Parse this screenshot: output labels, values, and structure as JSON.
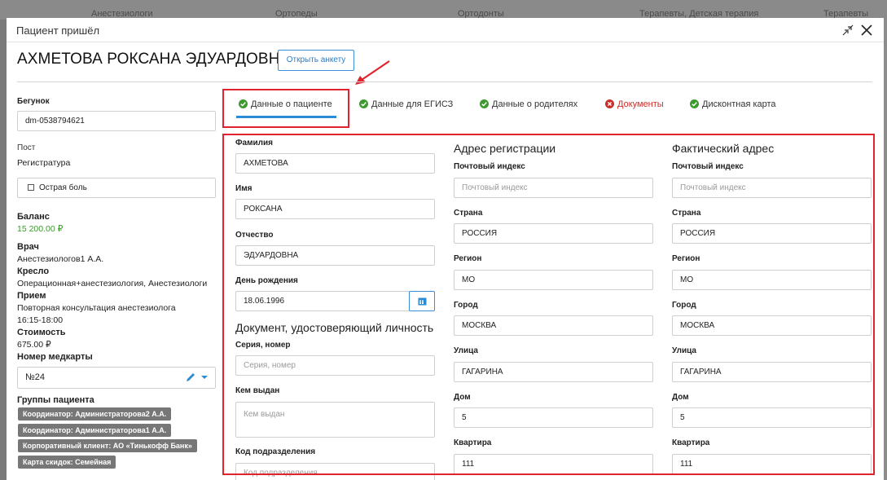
{
  "background": {
    "columns": [
      "Анестезиологи",
      "Ортопеды",
      "Ортодонты",
      "Терапевты, Детская терапия",
      "Терапевты"
    ]
  },
  "modal": {
    "title": "Пациент пришёл",
    "patient_name": "АХМЕТОВА РОКСАНА ЭДУАРДОВНА",
    "open_form_label": "Открыть анкету"
  },
  "left": {
    "runner_label": "Бегунок",
    "runner_value": "dm-0538794621",
    "post_label": "Пост",
    "post_value": "Регистратура",
    "acute_pain_label": "Острая боль",
    "acute_pain_checked": false,
    "balance_label": "Баланс",
    "balance_value": "15 200.00 ₽",
    "doctor_label": "Врач",
    "doctor_value": "Анестезиологов1 А.А.",
    "chair_label": "Кресло",
    "chair_value": "Операционная+анестезиология, Анестезиологи",
    "appointment_label": "Прием",
    "appointment_value": "Повторная консультация анестезиолога",
    "appointment_time": "16:15-18:00",
    "cost_label": "Стоимость",
    "cost_value": "675.00 ₽",
    "card_number_label": "Номер медкарты",
    "card_number_value": "№24",
    "groups_label": "Группы пациента",
    "groups": [
      "Координатор: Администраторова2 А.А.",
      "Координатор: Администраторова1 А.А.",
      "Корпоративный клиент: АО «Тинькофф Банк»",
      "Карта скидок: Семейная"
    ]
  },
  "tabs": [
    {
      "label": "Данные о пациенте",
      "status": "ok",
      "active": true
    },
    {
      "label": "Данные для ЕГИСЗ",
      "status": "ok",
      "active": false
    },
    {
      "label": "Данные о родителях",
      "status": "ok",
      "active": false
    },
    {
      "label": "Документы",
      "status": "error",
      "active": false
    },
    {
      "label": "Дисконтная карта",
      "status": "ok",
      "active": false
    }
  ],
  "form": {
    "lastname_label": "Фамилия",
    "lastname_value": "АХМЕТОВА",
    "firstname_label": "Имя",
    "firstname_value": "РОКСАНА",
    "patronymic_label": "Отчество",
    "patronymic_value": "ЭДУАРДОВНА",
    "birthday_label": "День рождения",
    "birthday_value": "18.06.1996",
    "id_doc_title": "Документ, удостоверяющий личность",
    "series_label": "Серия, номер",
    "series_placeholder": "Серия, номер",
    "issued_label": "Кем выдан",
    "issued_placeholder": "Кем выдан",
    "dept_code_label": "Код подразделения",
    "dept_code_placeholder": "Код подразделения"
  },
  "reg_address": {
    "title": "Адрес регистрации",
    "zip_label": "Почтовый индекс",
    "zip_placeholder": "Почтовый индекс",
    "country_label": "Страна",
    "country_value": "РОССИЯ",
    "region_label": "Регион",
    "region_value": "МО",
    "city_label": "Город",
    "city_value": "МОСКВА",
    "street_label": "Улица",
    "street_value": "ГАГАРИНА",
    "house_label": "Дом",
    "house_value": "5",
    "flat_label": "Квартира",
    "flat_value": "111"
  },
  "fact_address": {
    "title": "Фактический адрес",
    "zip_label": "Почтовый индекс",
    "zip_placeholder": "Почтовый индекс",
    "country_label": "Страна",
    "country_value": "РОССИЯ",
    "region_label": "Регион",
    "region_value": "МО",
    "city_label": "Город",
    "city_value": "МОСКВА",
    "street_label": "Улица",
    "street_value": "ГАГАРИНА",
    "house_label": "Дом",
    "house_value": "5",
    "flat_label": "Квартира",
    "flat_value": "111"
  },
  "colors": {
    "accent": "#2b8bd4",
    "ok_green": "#3c9a2e",
    "error_red": "#c9302c",
    "annotation_red": "#e0232c",
    "tag_gray": "#777777"
  }
}
